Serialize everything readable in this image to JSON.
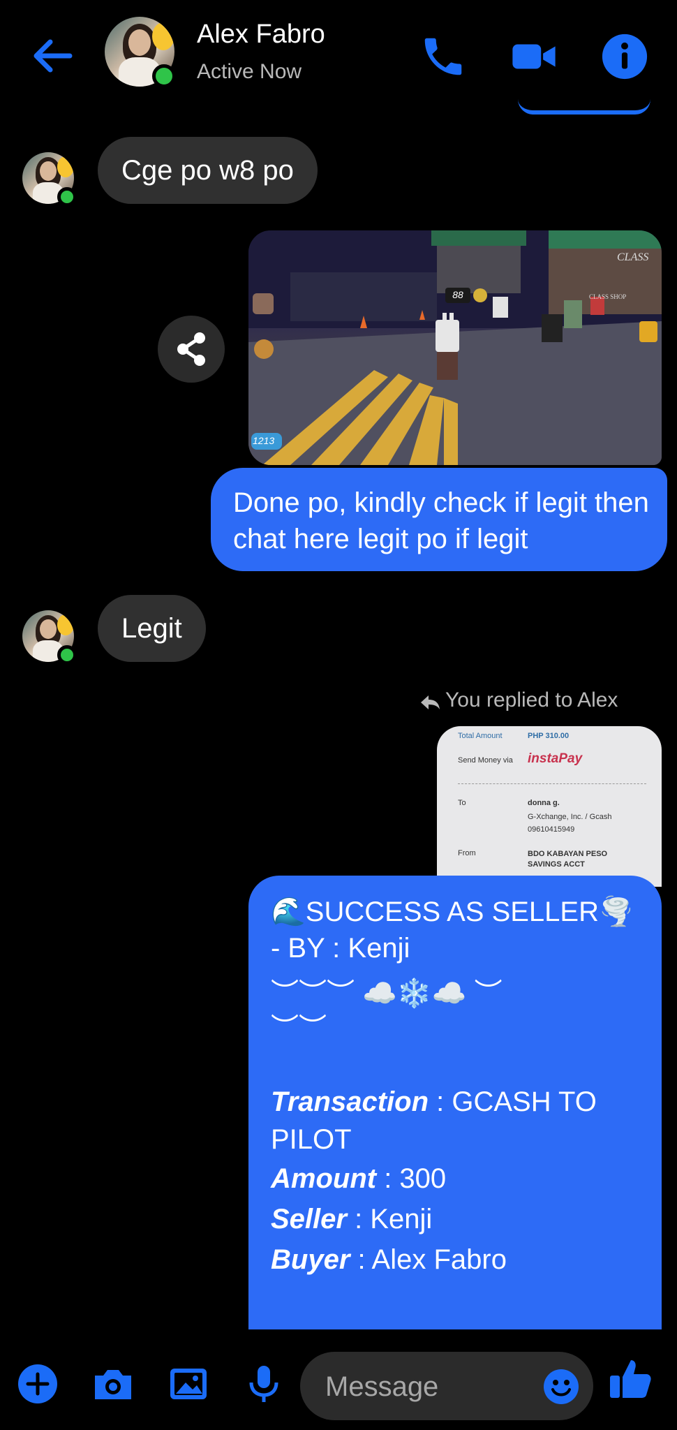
{
  "header": {
    "contact_name": "Alex Fabro",
    "status": "Active Now",
    "icons": [
      "back-arrow-icon",
      "phone-icon",
      "video-camera-icon",
      "info-icon"
    ]
  },
  "messages": {
    "incoming_1": "Cge po w8 po",
    "outgoing_1": "Done po, kindly check if legit then chat here legit po if legit",
    "incoming_2": "Legit",
    "reply_label": "You replied to Alex"
  },
  "game_image": {
    "hud_counter": "88",
    "hud_coins": "1213",
    "sign_text": "CLASS",
    "shop_text": "CLASS SHOP"
  },
  "receipt": {
    "total_amount_label": "Total Amount",
    "total_amount_value": "PHP 310.00",
    "send_money_label": "Send Money via",
    "send_money_value": "instaPay",
    "to_label": "To",
    "to_name": "donna g.",
    "to_provider": "G-Xchange, Inc. / Gcash",
    "to_number": "09610415949",
    "from_label": "From",
    "from_value": "BDO KABAYAN PESO SAVINGS ACCT"
  },
  "success_message": {
    "title": "🌊SUCCESS AS SELLER🌪️",
    "by_line": "- BY : Kenji",
    "decor_1": "︶︶︶ ☁️❄️☁️ ︶",
    "decor_2": "︶︶",
    "transaction_label": "Transaction",
    "transaction_value": " : GCASH TO",
    "transaction_value_2": "PILOT",
    "amount_label": "Amount",
    "amount_value": " : 300",
    "seller_label": "Seller",
    "seller_value": " : Kenji",
    "buyer_label": "Buyer",
    "buyer_value": " : Alex Fabro"
  },
  "composer": {
    "placeholder": "Message",
    "icons": [
      "plus-icon",
      "camera-icon",
      "gallery-icon",
      "microphone-icon",
      "emoji-icon",
      "thumbs-up-icon"
    ]
  },
  "colors": {
    "accent": "#2d6bf6",
    "icon_blue": "#1b6cf7",
    "online": "#2fc449",
    "incoming_bubble": "#303030"
  }
}
